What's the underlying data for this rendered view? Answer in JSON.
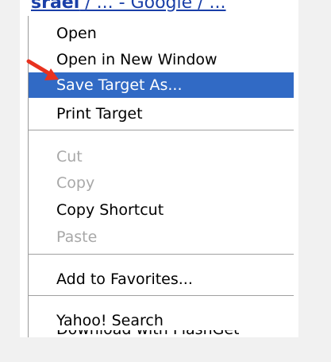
{
  "top_link": {
    "part1": "srael",
    "part2": " / ... - Google / ..."
  },
  "menu": {
    "items": [
      {
        "label": "Open",
        "state": "normal"
      },
      {
        "label": "Open in New Window",
        "state": "normal"
      },
      {
        "label": "Save Target As...",
        "state": "highlighted"
      },
      {
        "label": "Print Target",
        "state": "normal"
      },
      {
        "label": "Cut",
        "state": "disabled"
      },
      {
        "label": "Copy",
        "state": "disabled"
      },
      {
        "label": "Copy Shortcut",
        "state": "normal"
      },
      {
        "label": "Paste",
        "state": "disabled"
      },
      {
        "label": "Add to Favorites...",
        "state": "normal"
      },
      {
        "label": "Yahoo! Search",
        "state": "normal"
      },
      {
        "label": "Download with FlashGet",
        "state": "partially-visible"
      }
    ]
  },
  "annotation": {
    "icon": "red-arrow-icon",
    "color": "#e8321f"
  },
  "colors": {
    "highlight": "#316ac5",
    "disabled_text": "#a8a8a8",
    "frame": "#f1f1f1"
  }
}
